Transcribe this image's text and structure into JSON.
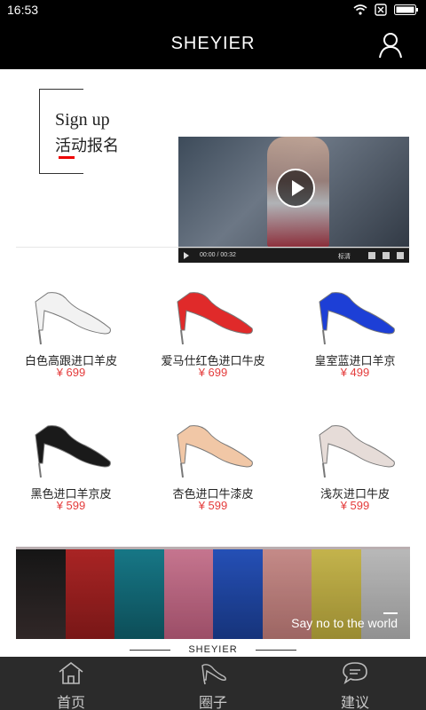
{
  "status_bar": {
    "time": "16:53"
  },
  "header": {
    "title": "SHEYIER"
  },
  "promo": {
    "signup_en": "Sign up",
    "signup_cn": "活动报名",
    "video": {
      "time": "00:00 / 00:32",
      "quality_label": "标清",
      "progress": 0
    }
  },
  "products": [
    {
      "name": "白色高跟进口羊皮",
      "price": "¥ 699",
      "color": "#f2f2f2"
    },
    {
      "name": "爱马仕红色进口牛皮",
      "price": "¥ 699",
      "color": "#e02a2a"
    },
    {
      "name": "皇室蓝进口羊京",
      "price": "¥ 499",
      "color": "#1d3fd6"
    },
    {
      "name": "黑色进口羊京皮",
      "price": "¥ 599",
      "color": "#1a1a1a"
    },
    {
      "name": "杏色进口牛漆皮",
      "price": "¥ 599",
      "color": "#f1c7a6"
    },
    {
      "name": "浅灰进口牛皮",
      "price": "¥ 599",
      "color": "#e6dcd8"
    }
  ],
  "banner": {
    "text": "Say no to the world"
  },
  "brand_footer": "SHEYIER",
  "tabs": [
    {
      "label": "首页",
      "icon": "home-icon"
    },
    {
      "label": "圈子",
      "icon": "heel-icon"
    },
    {
      "label": "建议",
      "icon": "chat-bubble-icon"
    }
  ],
  "colors": {
    "accent_red": "#e43c3c",
    "bar_black": "#000000",
    "tabbar_bg": "#2b2b2b"
  }
}
